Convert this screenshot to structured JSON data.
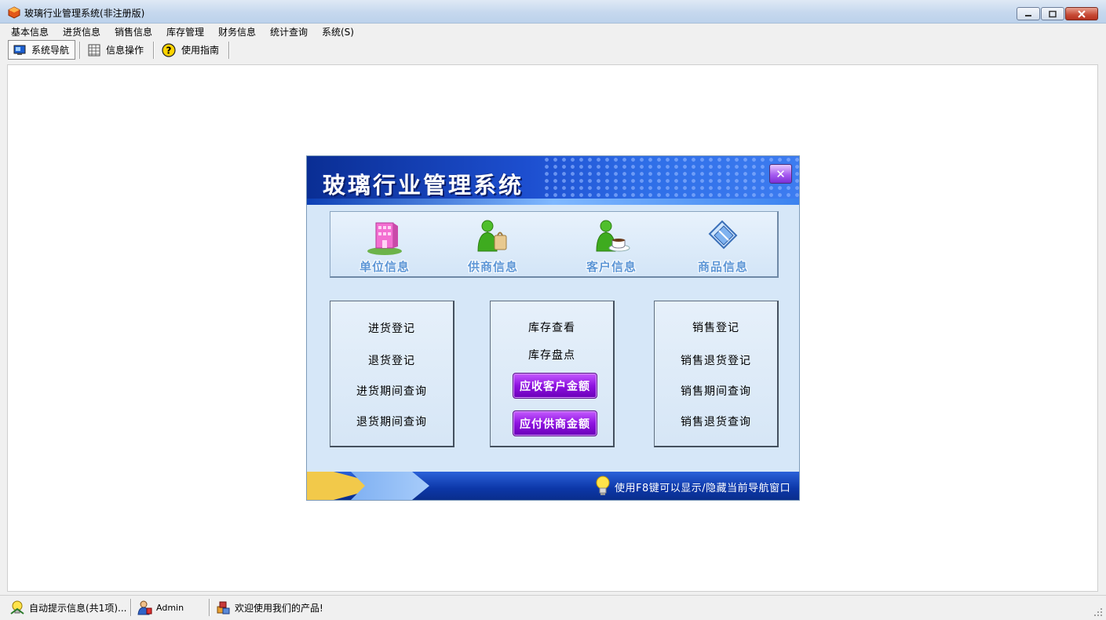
{
  "window": {
    "title": "玻璃行业管理系统(非注册版)"
  },
  "menu": [
    "基本信息",
    "进货信息",
    "销售信息",
    "库存管理",
    "财务信息",
    "统计查询",
    "系统(S)"
  ],
  "toolbar": {
    "nav": "系统导航",
    "ops": "信息操作",
    "guide": "使用指南"
  },
  "navigator": {
    "title": "玻璃行业管理系统",
    "icons": [
      {
        "label": "单位信息",
        "icon": "building-icon"
      },
      {
        "label": "供商信息",
        "icon": "supplier-icon"
      },
      {
        "label": "客户信息",
        "icon": "customer-icon"
      },
      {
        "label": "商品信息",
        "icon": "goods-icon"
      }
    ],
    "purchase": [
      "进货登记",
      "退货登记",
      "进货期间查询",
      "退货期间查询"
    ],
    "stock": {
      "items": [
        "库存查看",
        "库存盘点"
      ],
      "receivable": "应收客户金额",
      "payable": "应付供商金额"
    },
    "sales": [
      "销售登记",
      "销售退货登记",
      "销售期间查询",
      "销售退货查询"
    ],
    "hint": "使用F8键可以显示/隐藏当前导航窗口"
  },
  "status": {
    "info": "自动提示信息(共1项)...",
    "user": "Admin",
    "welcome": "欢迎使用我们的产品!"
  },
  "colors": {
    "accent_purple": "#8e12e0",
    "nav_blue": "#1d4fd0",
    "panel_bg": "#d6e7f8"
  }
}
